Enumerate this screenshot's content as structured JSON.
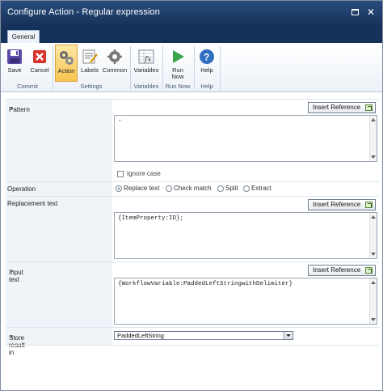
{
  "window": {
    "title": "Configure Action - Regular expression"
  },
  "tabs": [
    {
      "label": "General"
    }
  ],
  "ribbon": {
    "buttons": [
      {
        "label": "Save"
      },
      {
        "label": "Cancel"
      },
      {
        "label": "Action"
      },
      {
        "label": "Labels"
      },
      {
        "label": "Common"
      },
      {
        "label": "Variables"
      },
      {
        "label": "Run\nNow"
      },
      {
        "label": "Help"
      }
    ],
    "groups": [
      {
        "label": "Commit"
      },
      {
        "label": "Settings"
      },
      {
        "label": "Variables"
      },
      {
        "label": "Run Now"
      },
      {
        "label": "Help"
      }
    ]
  },
  "form": {
    "insert_reference_label": "Insert Reference",
    "pattern": {
      "label": "Pattern",
      "required": "*",
      "value": "-",
      "ignore_case_label": "Ignore case"
    },
    "operation": {
      "label": "Operation",
      "options": [
        {
          "label": "Replace text"
        },
        {
          "label": "Check match"
        },
        {
          "label": "Split"
        },
        {
          "label": "Extract"
        }
      ]
    },
    "replacement": {
      "label": "Replacement text",
      "value": "{ItemProperty:ID};"
    },
    "input": {
      "label": "Input text",
      "required": "*",
      "value": "{WorkflowVariable:PaddedLeftStringwithDelimiter}"
    },
    "store": {
      "label": "Store result in",
      "required": "*",
      "value": "PaddedLeftString"
    }
  }
}
